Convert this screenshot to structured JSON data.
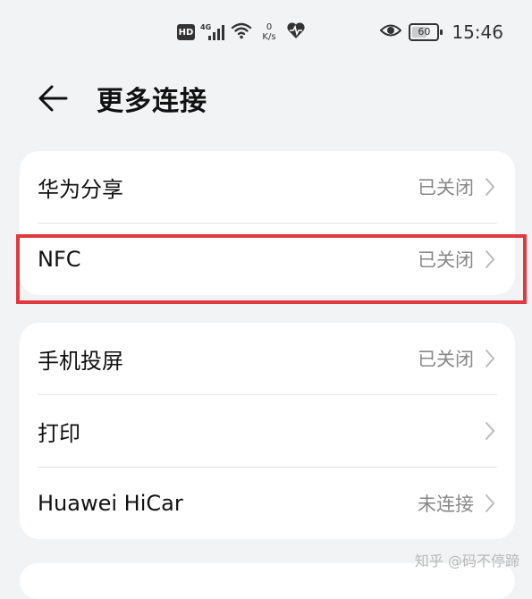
{
  "status_bar": {
    "hd": "HD",
    "network": "4G",
    "speed_value": "0",
    "speed_unit": "K/s",
    "battery": "60",
    "time": "15:46",
    "icons": [
      "hd-icon",
      "signal-icon",
      "wifi-icon",
      "heartbeat-icon",
      "eye-icon",
      "battery-icon"
    ]
  },
  "header": {
    "title": "更多连接",
    "back_icon": "back-arrow-icon"
  },
  "group1": {
    "items": [
      {
        "label": "华为分享",
        "status": "已关闭"
      },
      {
        "label": "NFC",
        "status": "已关闭"
      }
    ]
  },
  "group2": {
    "items": [
      {
        "label": "手机投屏",
        "status": "已关闭"
      },
      {
        "label": "打印",
        "status": ""
      },
      {
        "label": "Huawei HiCar",
        "status": "未连接"
      }
    ]
  },
  "watermark": "知乎 @码不停蹄",
  "colors": {
    "background": "#f1f3f5",
    "card": "#ffffff",
    "highlight": "#e13a3e",
    "status_text": "#888888"
  }
}
